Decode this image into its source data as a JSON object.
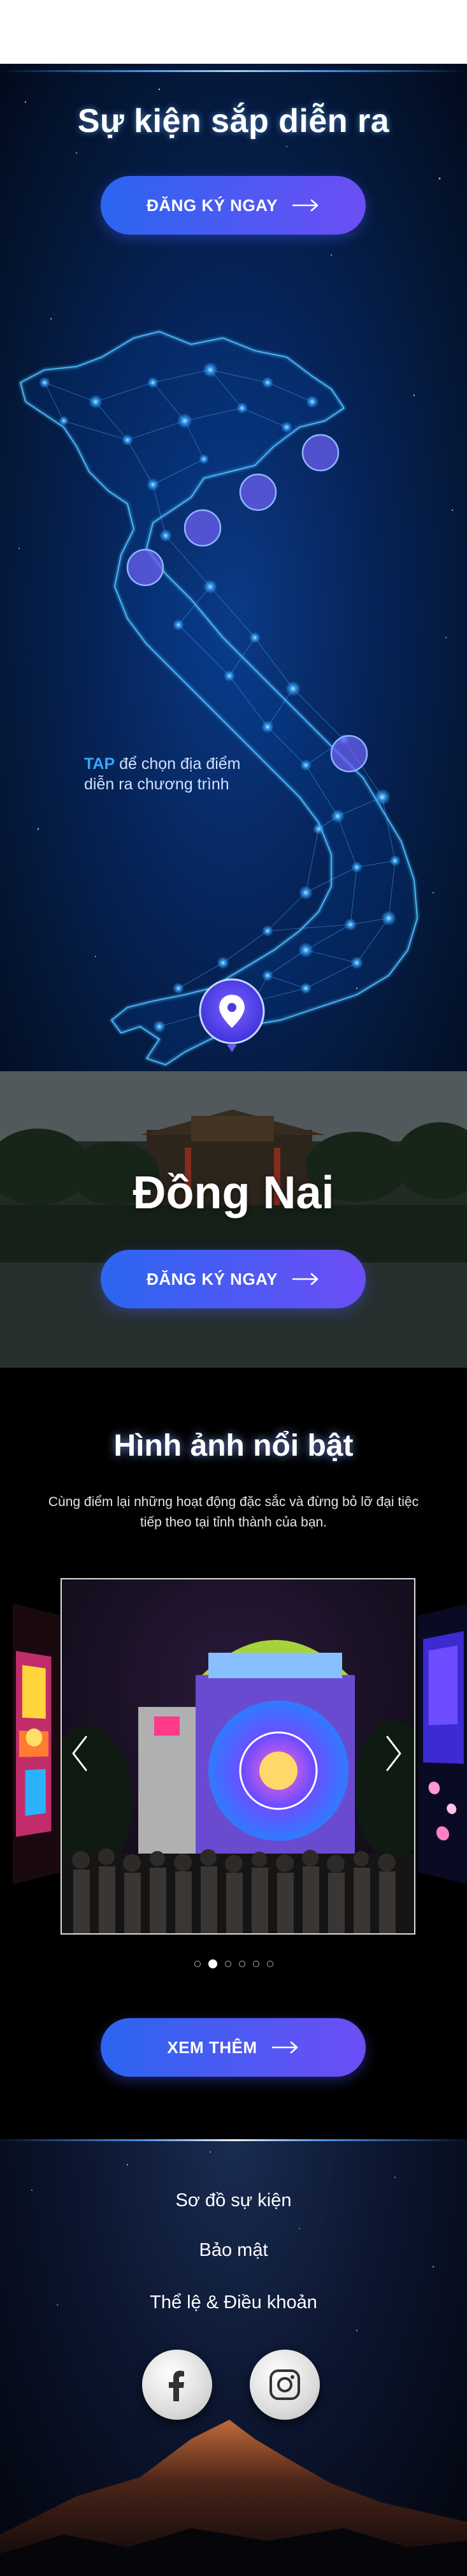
{
  "hero": {
    "title": "Sự kiện sắp diễn ra",
    "register_label": "ĐĂNG KÝ NGAY",
    "tap_keyword": "TAP",
    "tap_text_line1": " để chọn địa điểm",
    "tap_text_line2": "diễn ra chương trình",
    "map_markers": [
      "location-pin-icon"
    ]
  },
  "city": {
    "name": "Đồng Nai",
    "register_label": "ĐĂNG KÝ NGAY"
  },
  "gallery": {
    "title": "Hình ảnh nổi bật",
    "description": "Cùng điểm lại những hoạt động đặc sắc và đừng bỏ lỡ đại tiệc tiếp theo tại tỉnh thành của bạn.",
    "slide_count": 6,
    "active_slide": 2,
    "more_label": "XEM THÊM"
  },
  "footer": {
    "links": [
      "Sơ đồ sự kiện",
      "Bảo mật",
      "Thể lệ & Điều khoản"
    ],
    "social": [
      "facebook-icon",
      "instagram-icon"
    ]
  },
  "colors": {
    "button_gradient_start": "#2b66f0",
    "button_gradient_end": "#6c4ef5",
    "accent_blue": "#36a8ff"
  }
}
